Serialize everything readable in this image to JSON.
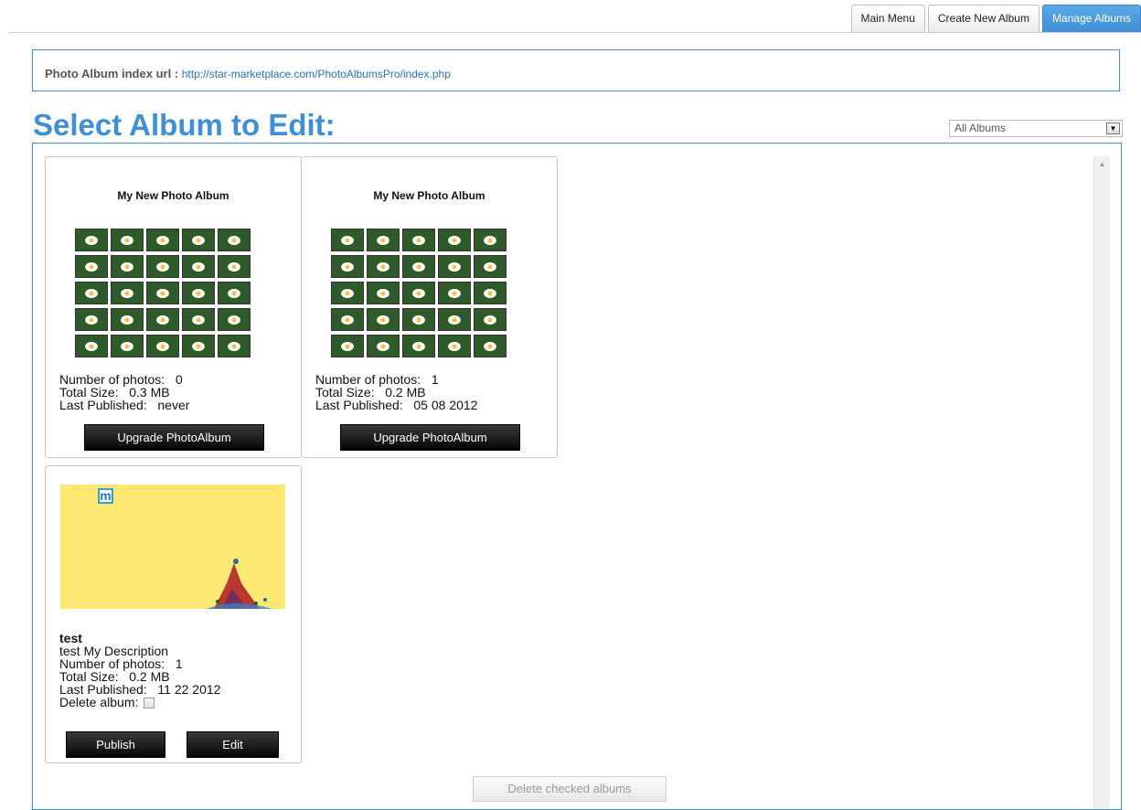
{
  "tabs": [
    "Main Menu",
    "Create New Album",
    "Manage Albums"
  ],
  "active_tab": "Manage Albums",
  "url_box": {
    "label": "Photo Album index url :",
    "url": "http://star-marketplace.com/PhotoAlbumsPro/index.php"
  },
  "page_title": "Select Album to Edit:",
  "filter": {
    "selected": "All Albums"
  },
  "albums": [
    {
      "title": "My New Photo Album",
      "number_of_photos": "Number of photos:   0",
      "total_size": "Total Size:   0.3 MB",
      "last_published": "Last Published:   never",
      "button": "Upgrade PhotoAlbum"
    },
    {
      "title": "My New Photo Album",
      "number_of_photos": "Number of photos:   1",
      "total_size": "Total Size:   0.2 MB",
      "last_published": "Last Published:   05 08 2012",
      "button": "Upgrade PhotoAlbum"
    },
    {
      "name": "test",
      "description": "test My Description",
      "number_of_photos": "Number of photos:   1",
      "total_size": "Total Size:   0.2 MB",
      "last_published": "Last Published:   11 22 2012",
      "delete_label": "Delete album:",
      "publish_button": "Publish",
      "edit_button": "Edit",
      "cover_logo": "m"
    }
  ],
  "delete_checked_button": "Delete checked albums",
  "colors": {
    "accent": "#3e8fd6",
    "cover_bg": "#fde873"
  }
}
